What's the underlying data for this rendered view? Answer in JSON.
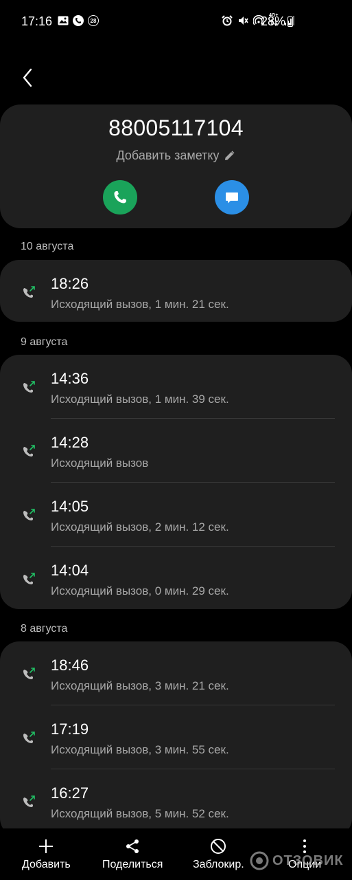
{
  "status_bar": {
    "time": "17:16",
    "notification_badge": "28",
    "battery_percent": "28%",
    "network_label": "4G+",
    "icons_left": [
      "gallery-icon",
      "phone-icon",
      "badge-icon"
    ],
    "icons_right": [
      "alarm-icon",
      "mute-icon",
      "hotspot-icon",
      "data-icon",
      "signal-icon",
      "battery-icon"
    ]
  },
  "header": {
    "phone_number": "88005117104",
    "add_note": "Добавить заметку"
  },
  "sections": [
    {
      "date": "10 августа",
      "calls": [
        {
          "time": "18:26",
          "description": "Исходящий вызов, 1 мин. 21 сек."
        }
      ]
    },
    {
      "date": "9 августа",
      "calls": [
        {
          "time": "14:36",
          "description": "Исходящий вызов, 1 мин. 39 сек."
        },
        {
          "time": "14:28",
          "description": "Исходящий вызов"
        },
        {
          "time": "14:05",
          "description": "Исходящий вызов, 2 мин. 12 сек."
        },
        {
          "time": "14:04",
          "description": "Исходящий вызов, 0 мин. 29 сек."
        }
      ]
    },
    {
      "date": "8 августа",
      "calls": [
        {
          "time": "18:46",
          "description": "Исходящий вызов, 3 мин. 21 сек."
        },
        {
          "time": "17:19",
          "description": "Исходящий вызов, 3 мин. 55 сек."
        },
        {
          "time": "16:27",
          "description": "Исходящий вызов, 5 мин. 52 сек."
        }
      ]
    }
  ],
  "bottom_bar": {
    "add": "Добавить",
    "share": "Поделиться",
    "block": "Заблокир.",
    "options": "Опции"
  },
  "watermark": "ОТЗОВИК",
  "colors": {
    "call_green": "#1aa35a",
    "message_blue": "#2b8fe6",
    "outgoing_arrow": "#21c065",
    "card_bg": "#1f1f1f"
  }
}
